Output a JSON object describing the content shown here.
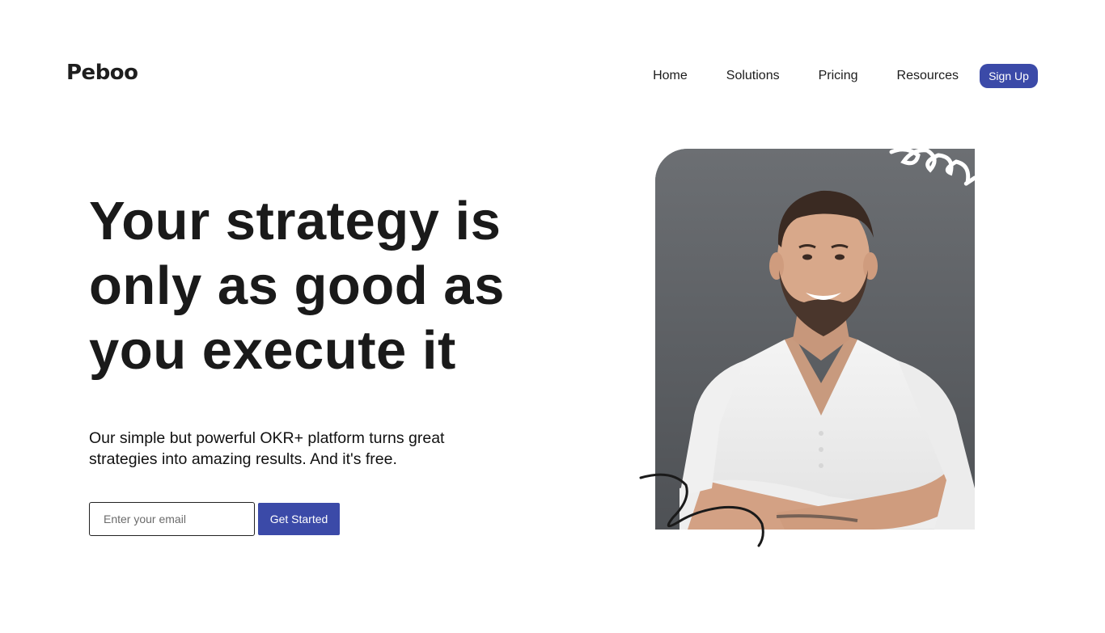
{
  "brand": {
    "name": "Peboo",
    "accent_color": "#3b4aa8"
  },
  "nav": {
    "items": [
      {
        "label": "Home"
      },
      {
        "label": "Solutions"
      },
      {
        "label": "Pricing"
      },
      {
        "label": "Resources"
      }
    ],
    "signup_label": "Sign Up"
  },
  "hero": {
    "title": "Your strategy is only as good as you execute it",
    "subtitle": "Our simple but powerful OKR+ platform turns great strategies into amazing results. And it's free.",
    "email_placeholder": "Enter your email",
    "cta_label": "Get Started",
    "image": {
      "subject": "smiling man with beard in white henley shirt, arms crossed",
      "background_color": "#5f6266"
    }
  }
}
